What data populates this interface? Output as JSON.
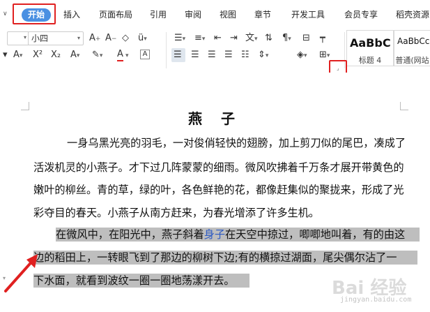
{
  "ribbon": {
    "tabs": [
      "开始",
      "插入",
      "页面布局",
      "引用",
      "审阅",
      "视图",
      "章节",
      "开发工具",
      "会员专享",
      "稻壳资源"
    ]
  },
  "toolbar": {
    "font_name_value": "",
    "font_size_value": "小四",
    "styles": [
      {
        "sample": "AaBbC",
        "label": "标题 4"
      },
      {
        "sample": "AaBbCc",
        "label": "普通(网站"
      }
    ]
  },
  "document": {
    "title": "燕 子",
    "lines": [
      "一身乌黑光亮的羽毛，一对俊俏轻快的翅膀，加上剪刀似的尾巴，凑成了",
      "活泼机灵的小燕子。才下过几阵蒙蒙的细雨。微风吹拂着千万条才展开带黄色的",
      "嫩叶的柳丝。青的草，绿的叶，各色鲜艳的花，都像赶集似的聚拢来，形成了光",
      "彩夺目的春天。小燕子从南方赶来，为春光增添了许多生机。"
    ],
    "selected_line1_a": "在微风中，在阳光中，燕子斜着",
    "selected_line1_link": "身子",
    "selected_line1_b": "在天空中掠过，唧唧地叫着，有的由这",
    "selected_line2": "边的稻田上，一转眼飞到了那边的柳树下边;有的横掠过湖面，尾尖偶尔沾了一",
    "selected_line3": "下水面，就看到波纹一圈一圈地荡漾开去。"
  },
  "watermark": {
    "main": "Bai 经验",
    "sub": "jingyan.baidu.com"
  },
  "colors": {
    "home_tab_bg": "#4a90e2",
    "annotation_red": "#e02020",
    "selection_gray": "#bebebe"
  }
}
